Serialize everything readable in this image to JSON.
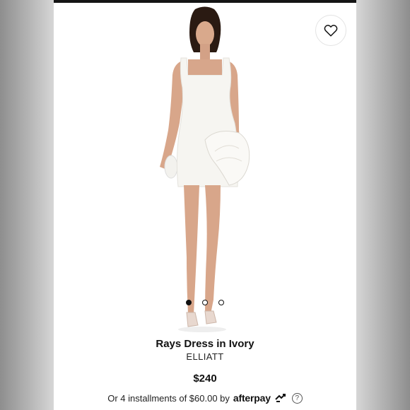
{
  "product": {
    "title": "Rays Dress in Ivory",
    "brand": "ELLIATT",
    "price": "$240",
    "installments_text": "Or 4 installments of $60.00 by",
    "afterpay_logo": "afterpay",
    "help_glyph": "?"
  },
  "gallery": {
    "image_count": 3,
    "active_index": 0
  },
  "icons": {
    "wishlist": "heart-icon",
    "afterpay": "afterpay-arrows-icon",
    "help": "question-circle-icon"
  },
  "colors": {
    "card_bg": "#ffffff",
    "text": "#111111",
    "dress": "#f6f5f1",
    "hair": "#2a1a12",
    "skin": "#d9a98c"
  }
}
